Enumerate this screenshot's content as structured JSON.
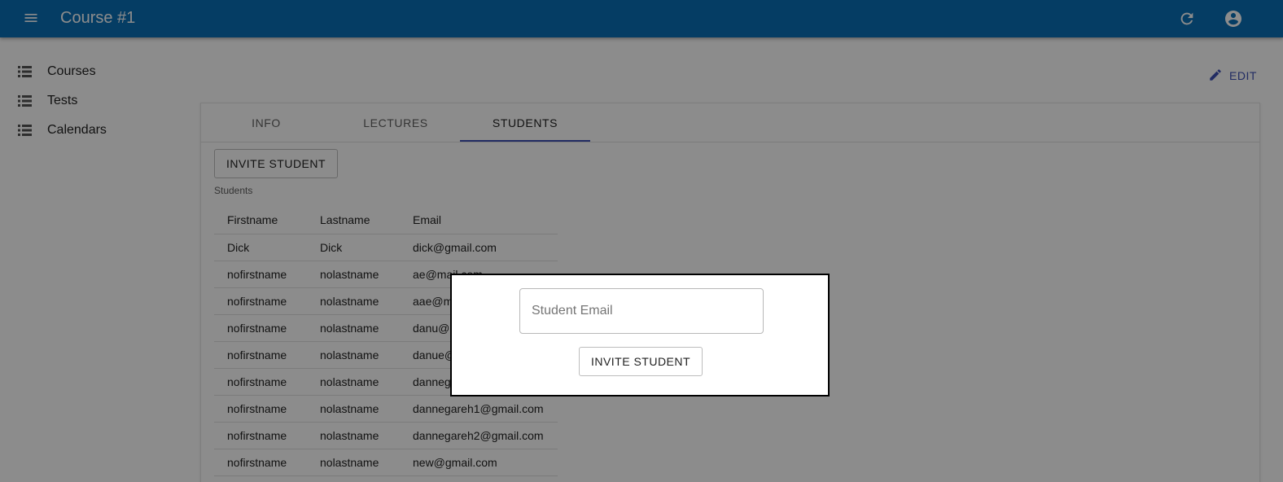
{
  "appbar": {
    "title": "Course #1",
    "menu_icon": "menu-icon",
    "refresh_icon": "refresh-icon",
    "account_icon": "account-circle-icon",
    "color": "#0a6fb6"
  },
  "sidebar": {
    "items": [
      {
        "label": "Courses",
        "icon": "list-icon"
      },
      {
        "label": "Tests",
        "icon": "list-icon"
      },
      {
        "label": "Calendars",
        "icon": "list-icon"
      }
    ]
  },
  "toolbar": {
    "edit_label": "EDIT",
    "edit_icon": "pencil-icon",
    "accent": "#3f51b5"
  },
  "tabs": [
    {
      "label": "INFO",
      "active": false
    },
    {
      "label": "LECTURES",
      "active": false
    },
    {
      "label": "STUDENTS",
      "active": true
    }
  ],
  "students": {
    "invite_label": "INVITE STUDENT",
    "caption": "Students",
    "columns": [
      "Firstname",
      "Lastname",
      "Email"
    ],
    "rows": [
      [
        "Dick",
        "Dick",
        "dick@gmail.com"
      ],
      [
        "nofirstname",
        "nolastname",
        "ae@mail.com"
      ],
      [
        "nofirstname",
        "nolastname",
        "aae@mail.com"
      ],
      [
        "nofirstname",
        "nolastname",
        "danu@gmail.com"
      ],
      [
        "nofirstname",
        "nolastname",
        "danue@gmail.com"
      ],
      [
        "nofirstname",
        "nolastname",
        "dannegareh@gmail.com"
      ],
      [
        "nofirstname",
        "nolastname",
        "dannegareh1@gmail.com"
      ],
      [
        "nofirstname",
        "nolastname",
        "dannegareh2@gmail.com"
      ],
      [
        "nofirstname",
        "nolastname",
        "new@gmail.com"
      ]
    ]
  },
  "modal": {
    "email_placeholder": "Student Email",
    "email_value": "",
    "invite_label": "INVITE STUDENT"
  }
}
